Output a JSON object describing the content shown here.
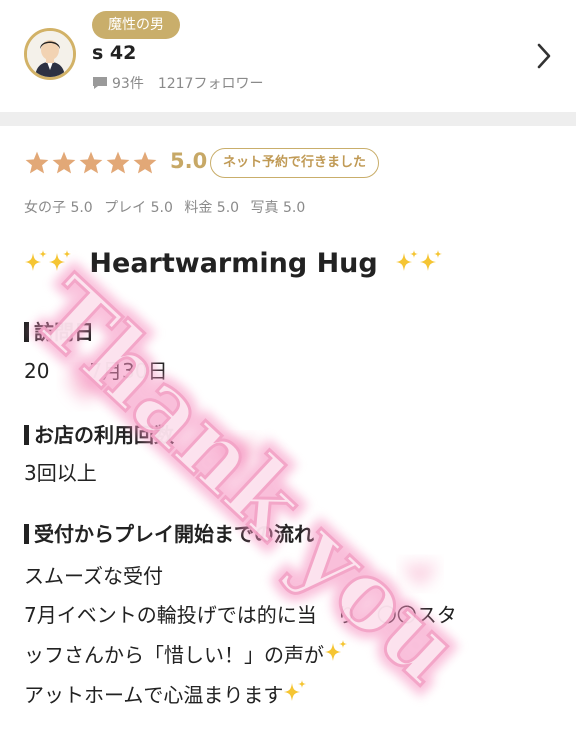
{
  "header": {
    "rank_badge": "魔性の男",
    "username": "s 42",
    "review_count": "93件",
    "followers": "1217フォロワー"
  },
  "review": {
    "stars": 5,
    "score": "5.0",
    "net_badge": "ネット予約で行きました",
    "subratings": [
      "女の子 5.0",
      "プレイ 5.0",
      "料金 5.0",
      "写真 5.0"
    ],
    "title": "Heartwarming Hug",
    "sections": {
      "visit_date_label": "訪問日",
      "visit_date_value": "20　　7月30日",
      "usage_label": "お店の利用回数",
      "usage_value": "3回以上",
      "flow_label": "受付からプレイ開始までの流れ",
      "flow_lines": [
        "スムーズな受付",
        "7月イベントの輪投げでは的に当　り　〇〇スタ",
        "ッフさんから「惜しい！」の声が",
        "アットホームで心温まります"
      ]
    }
  },
  "overlay": {
    "text": "Thank you"
  },
  "colors": {
    "gold": "#c9ae6b",
    "star": "#e2a877",
    "pink": "#f7a9c8"
  }
}
